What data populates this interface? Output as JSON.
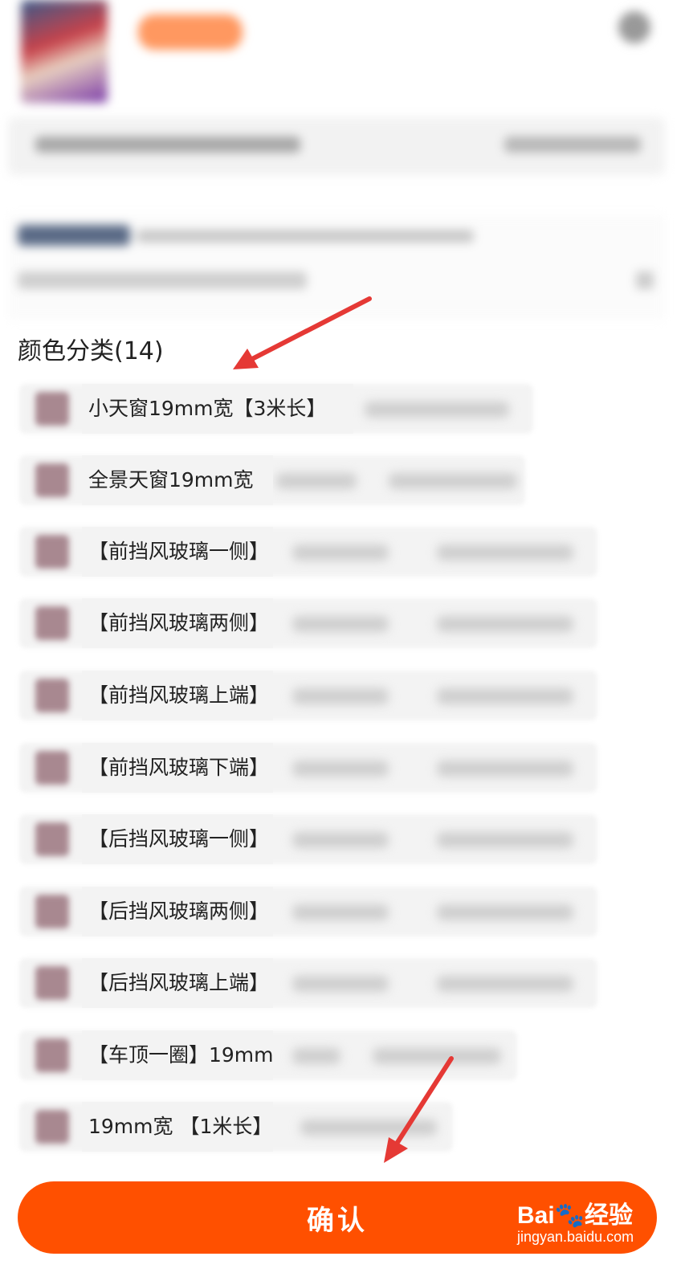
{
  "variant_section": {
    "title": "颜色分类(14)",
    "options": [
      {
        "label": "小天窗19mm宽【3米长】"
      },
      {
        "label": "全景天窗19mm宽"
      },
      {
        "label": "【前挡风玻璃一侧】"
      },
      {
        "label": "【前挡风玻璃两侧】"
      },
      {
        "label": "【前挡风玻璃上端】"
      },
      {
        "label": "【前挡风玻璃下端】"
      },
      {
        "label": "【后挡风玻璃一侧】"
      },
      {
        "label": "【后挡风玻璃两侧】"
      },
      {
        "label": "【后挡风玻璃上端】"
      },
      {
        "label": "【车顶一圈】19mm"
      },
      {
        "label": "19mm宽 【1米长】"
      }
    ]
  },
  "confirm_button": {
    "label": "确认",
    "color": "#ff5000"
  },
  "arrow_color": "#e53935",
  "watermark": {
    "brand": "Bai🐾经验",
    "url": "jingyan.baidu.com"
  }
}
